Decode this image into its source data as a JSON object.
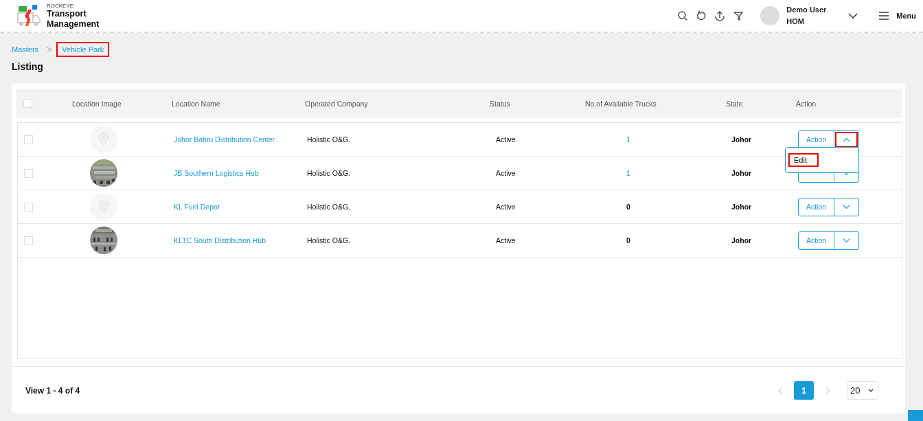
{
  "header": {
    "brand_company": "ROCKEYE",
    "brand_product": "Transport Management",
    "user": {
      "name": "Demo User",
      "role": "HOM"
    },
    "menu_label": "Menu"
  },
  "breadcrumb": [
    {
      "label": "Masters",
      "highlighted": false
    },
    {
      "label": "Vehicle Park",
      "highlighted": true
    }
  ],
  "page_title": "Listing",
  "table": {
    "header_checkbox": {
      "checked": false
    },
    "columns": [
      "Location Image",
      "Location Name",
      "Operated Company",
      "Status",
      "No.of Available Trucks",
      "State",
      "Action"
    ],
    "rows": [
      {
        "checked": false,
        "image": {
          "kind": "placeholder"
        },
        "location_name": "Johor Bahru Distribution Center",
        "operated_company": "Holistic O&G.",
        "status": "Active",
        "available_trucks": "1",
        "trucks_link": true,
        "state": "Johor",
        "action": {
          "label": "Action",
          "open": true,
          "highlighted": true
        }
      },
      {
        "checked": false,
        "location_name": "JB Southern Logistics Hub",
        "operated_company": "Holistic O&G.",
        "status": "Active",
        "available_trucks": "1",
        "trucks_link": true,
        "state": "Johor",
        "action": {
          "open": false,
          "highlighted": false
        }
      },
      {
        "checked": false,
        "image": {
          "kind": "placeholder"
        },
        "location_name": "KL Fuel Depot",
        "operated_company": "Holistic O&G.",
        "status": "Active",
        "available_trucks": "0",
        "trucks_link": false,
        "state": "Johor",
        "action": {
          "label": "Action",
          "open": false,
          "highlighted": false
        }
      },
      {
        "checked": false,
        "location_name": "KLTC South Distribution Hub",
        "operated_company": "Holistic O&G.",
        "status": "Active",
        "available_trucks": "0",
        "trucks_link": false,
        "state": "Johor",
        "action": {
          "label": "Action",
          "open": false,
          "highlighted": false
        }
      }
    ],
    "action_menu": {
      "items": [
        {
          "label": "Edit",
          "highlighted": true
        }
      ]
    }
  },
  "footer": {
    "summary": "View 1 - 4 of 4",
    "pagination": {
      "prev_disabled": true,
      "next_disabled": true,
      "pages": [
        {
          "label": "1",
          "selected": true
        }
      ],
      "page_size": "20"
    }
  }
}
